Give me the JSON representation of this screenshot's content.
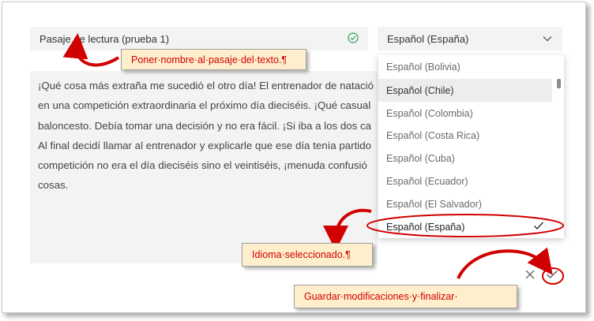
{
  "passage_title": {
    "value": "Pasaje de lectura (prueba 1)",
    "status_icon": "check-circle-icon"
  },
  "language_select": {
    "selected": "Español (España)",
    "icon": "chevron-down-icon"
  },
  "passage_text": "¡Qué cosa más extraña me sucedió el otro día! El entrenador de natació\nen una competición extraordinaria el próximo día dieciséis. ¡Qué casual\nbaloncesto. Debía tomar una decisión y no era fácil. ¡Si iba a los dos ca\nAl final decidí llamar al entrenador y explicarle que ese día tenía partido\ncompetición no era el día dieciséis sino el veintiséis, ¡menuda confusió\ncosas.",
  "language_options": [
    {
      "label": "Español (Bolivia)"
    },
    {
      "label": "Español (Chile)",
      "hover": true
    },
    {
      "label": "Español (Colombia)"
    },
    {
      "label": "Español (Costa Rica)"
    },
    {
      "label": "Español (Cuba)"
    },
    {
      "label": "Español (Ecuador)"
    },
    {
      "label": "Español (El Salvador)"
    },
    {
      "label": "Español (España)",
      "selected": true
    }
  ],
  "actions": {
    "cancel_icon": "close-icon",
    "confirm_icon": "checkmark-icon"
  },
  "annotations": {
    "name_passage": "Poner·nombre·al·pasaje·del·texto.¶",
    "language_selected": "Idioma·seleccionado.¶",
    "save_finish": "Guardar·modificaciones·y·finalizar·"
  },
  "colors": {
    "annotation_red": "#d00000",
    "callout_fill": "#ffeecb",
    "check_green": "#2e9e58"
  }
}
